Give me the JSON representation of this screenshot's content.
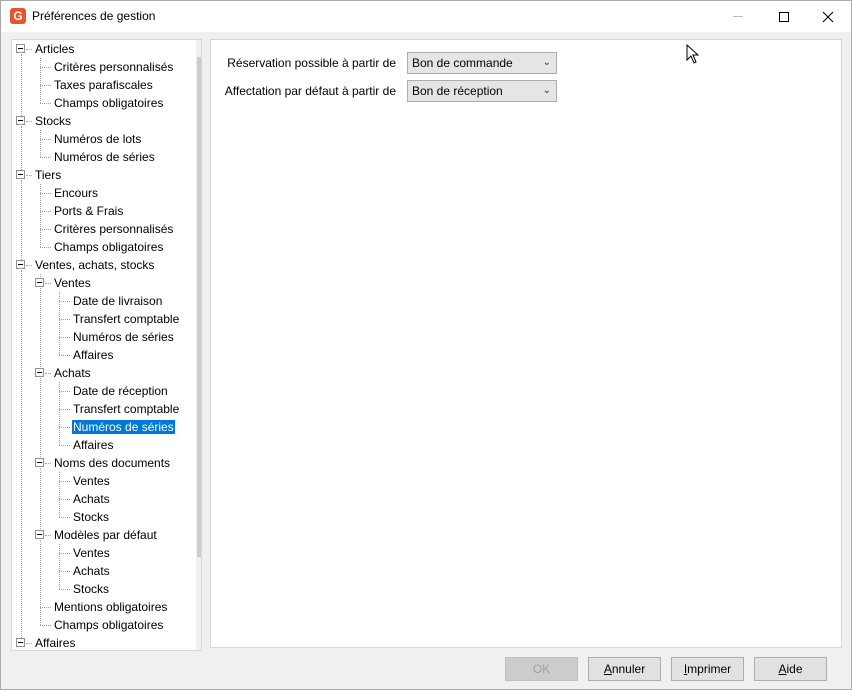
{
  "window": {
    "title": "Préférences de gestion",
    "app_icon_letter": "G",
    "accent_color": "#e8542c"
  },
  "tree": {
    "items": [
      {
        "label": "Articles",
        "level": 0,
        "expandable": true
      },
      {
        "label": "Critères personnalisés",
        "level": 1
      },
      {
        "label": "Taxes parafiscales",
        "level": 1
      },
      {
        "label": "Champs obligatoires",
        "level": 1
      },
      {
        "label": "Stocks",
        "level": 0,
        "expandable": true
      },
      {
        "label": "Numéros de lots",
        "level": 1
      },
      {
        "label": "Numéros de séries",
        "level": 1
      },
      {
        "label": "Tiers",
        "level": 0,
        "expandable": true
      },
      {
        "label": "Encours",
        "level": 1
      },
      {
        "label": "Ports & Frais",
        "level": 1
      },
      {
        "label": "Critères personnalisés",
        "level": 1
      },
      {
        "label": "Champs obligatoires",
        "level": 1
      },
      {
        "label": "Ventes, achats, stocks",
        "level": 0,
        "expandable": true
      },
      {
        "label": "Ventes",
        "level": 1,
        "expandable": true
      },
      {
        "label": "Date de livraison",
        "level": 2
      },
      {
        "label": "Transfert comptable",
        "level": 2
      },
      {
        "label": "Numéros de séries",
        "level": 2
      },
      {
        "label": "Affaires",
        "level": 2
      },
      {
        "label": "Achats",
        "level": 1,
        "expandable": true
      },
      {
        "label": "Date de réception",
        "level": 2
      },
      {
        "label": "Transfert comptable",
        "level": 2
      },
      {
        "label": "Numéros de séries",
        "level": 2,
        "selected": true
      },
      {
        "label": "Affaires",
        "level": 2
      },
      {
        "label": "Noms des documents",
        "level": 1,
        "expandable": true
      },
      {
        "label": "Ventes",
        "level": 2
      },
      {
        "label": "Achats",
        "level": 2
      },
      {
        "label": "Stocks",
        "level": 2
      },
      {
        "label": "Modèles par défaut",
        "level": 1,
        "expandable": true
      },
      {
        "label": "Ventes",
        "level": 2
      },
      {
        "label": "Achats",
        "level": 2
      },
      {
        "label": "Stocks",
        "level": 2
      },
      {
        "label": "Mentions obligatoires",
        "level": 1
      },
      {
        "label": "Champs obligatoires",
        "level": 1
      },
      {
        "label": "Affaires",
        "level": 0,
        "expandable": true
      }
    ],
    "selection_color": "#0078d7"
  },
  "settings": {
    "reservation_label": "Réservation possible à partir de",
    "reservation_value": "Bon de commande",
    "affectation_label": "Affectation par défaut à partir de",
    "affectation_value": "Bon de réception"
  },
  "buttons": {
    "ok": "OK",
    "annuler_first": "A",
    "annuler_rest": "nnuler",
    "imprimer_first": "I",
    "imprimer_rest": "mprimer",
    "aide_first": "A",
    "aide_rest": "ide"
  }
}
